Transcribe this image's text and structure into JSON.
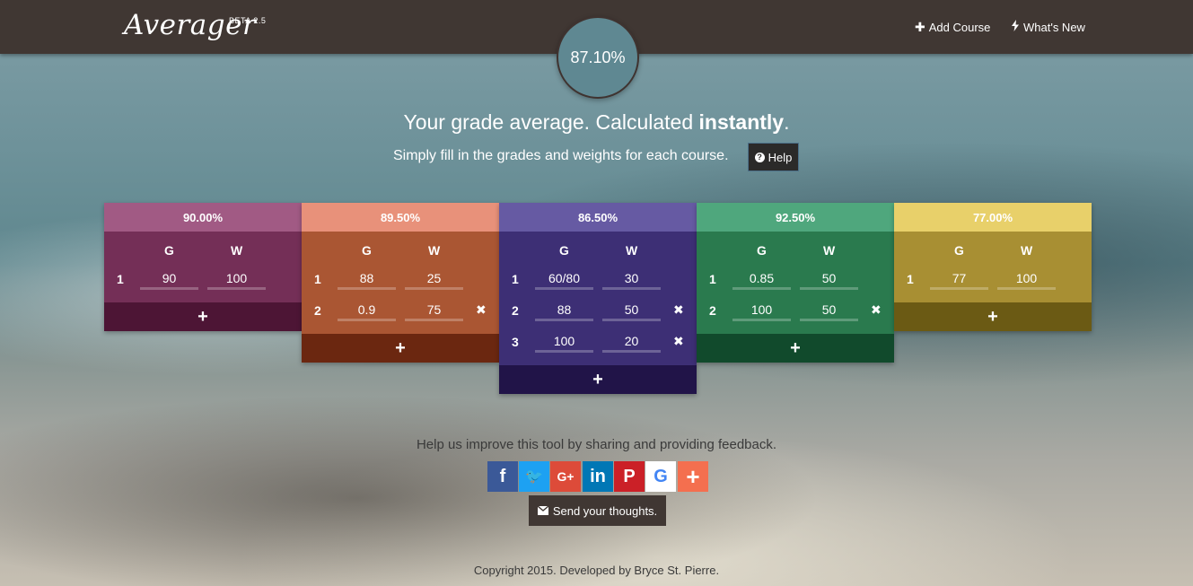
{
  "header": {
    "logo": "Averager",
    "beta": "BETA 2.5",
    "add_course": "Add Course",
    "whats_new": "What's New",
    "add_course_icon": "plus-icon",
    "whats_new_icon": "bolt-icon"
  },
  "average": "87.10%",
  "hero": {
    "headline_pre": "Your grade average. Calculated ",
    "headline_bold": "instantly",
    "headline_post": ".",
    "subline": "Simply fill in the grades and weights for each course.",
    "help": "Help"
  },
  "courses": [
    {
      "average": "90.00%",
      "col_g": "G",
      "col_w": "W",
      "colors": {
        "head": "#a15a84",
        "body": "#742f57",
        "foot": "#4d1535"
      },
      "rows": [
        {
          "num": "1",
          "grade": "90",
          "weight": "100",
          "delete": false
        }
      ],
      "add": "+"
    },
    {
      "average": "89.50%",
      "col_g": "G",
      "col_w": "W",
      "colors": {
        "head": "#e8917a",
        "body": "#aa5633",
        "foot": "#6b2710"
      },
      "rows": [
        {
          "num": "1",
          "grade": "88",
          "weight": "25",
          "delete": false
        },
        {
          "num": "2",
          "grade": "0.9",
          "weight": "75",
          "delete": true
        }
      ],
      "add": "+"
    },
    {
      "average": "86.50%",
      "col_g": "G",
      "col_w": "W",
      "colors": {
        "head": "#665aa3",
        "body": "#3d2f75",
        "foot": "#211448"
      },
      "rows": [
        {
          "num": "1",
          "grade": "60/80",
          "weight": "30",
          "delete": false
        },
        {
          "num": "2",
          "grade": "88",
          "weight": "50",
          "delete": true
        },
        {
          "num": "3",
          "grade": "100",
          "weight": "20",
          "delete": true
        }
      ],
      "add": "+"
    },
    {
      "average": "92.50%",
      "col_g": "G",
      "col_w": "W",
      "colors": {
        "head": "#4fa77d",
        "body": "#2a7a4e",
        "foot": "#114a2c"
      },
      "rows": [
        {
          "num": "1",
          "grade": "0.85",
          "weight": "50",
          "delete": false
        },
        {
          "num": "2",
          "grade": "100",
          "weight": "50",
          "delete": true
        }
      ],
      "add": "+"
    },
    {
      "average": "77.00%",
      "col_g": "G",
      "col_w": "W",
      "colors": {
        "head": "#e8d06a",
        "body": "#a88f33",
        "foot": "#6b5a14"
      },
      "rows": [
        {
          "num": "1",
          "grade": "77",
          "weight": "100",
          "delete": false
        }
      ],
      "add": "+"
    }
  ],
  "delete_glyph": "✖",
  "footer": {
    "feedback": "Help us improve this tool by sharing and providing feedback.",
    "social": [
      {
        "name": "facebook-icon",
        "glyph": "f",
        "color": "#3b5998"
      },
      {
        "name": "twitter-icon",
        "glyph": "🐦",
        "color": "#1da1f2"
      },
      {
        "name": "google-plus-icon",
        "glyph": "G+",
        "color": "#dd4b39"
      },
      {
        "name": "linkedin-icon",
        "glyph": "in",
        "color": "#0077b5"
      },
      {
        "name": "pinterest-icon",
        "glyph": "P",
        "color": "#cb2027"
      },
      {
        "name": "google-icon",
        "glyph": "G",
        "color": "#ffffff"
      },
      {
        "name": "more-share-icon",
        "glyph": "+",
        "color": "#f46f4f"
      }
    ],
    "send": "Send your thoughts.",
    "copyright": "Copyright 2015. Developed by Bryce St. Pierre."
  }
}
